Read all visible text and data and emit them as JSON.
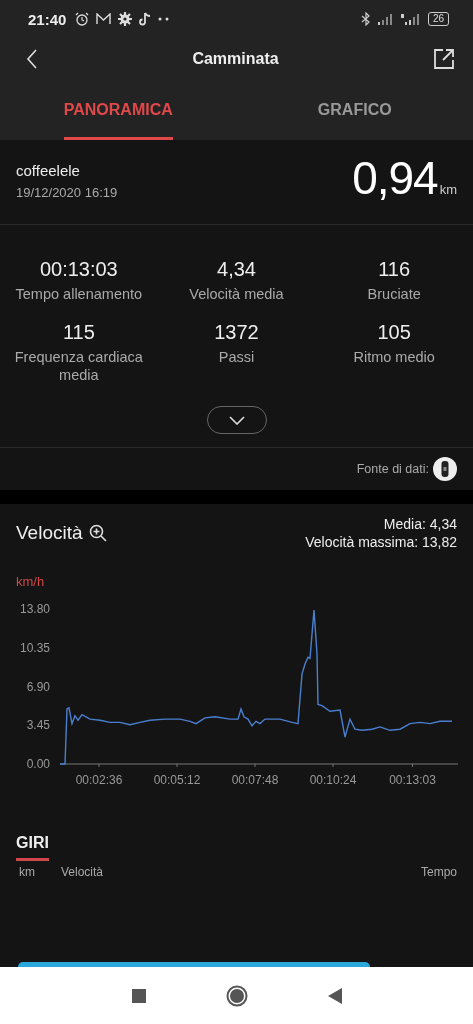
{
  "status_bar": {
    "time": "21:40",
    "battery": "26"
  },
  "header": {
    "title": "Camminata"
  },
  "tabs": [
    {
      "label": "PANORAMICA",
      "selected": true
    },
    {
      "label": "GRAFICO",
      "selected": false
    }
  ],
  "summary": {
    "user": "coffeelele",
    "datetime": "19/12/2020 16:19",
    "distance": "0,94",
    "unit": "km"
  },
  "stats": [
    {
      "value": "00:13:03",
      "label": "Tempo allenamento"
    },
    {
      "value": "4,34",
      "label": "Velocità media"
    },
    {
      "value": "116",
      "label": "Bruciate"
    },
    {
      "value": "115",
      "label": "Frequenza cardiaca media"
    },
    {
      "value": "1372",
      "label": "Passi"
    },
    {
      "value": "105",
      "label": "Ritmo medio"
    }
  ],
  "data_source": {
    "label": "Fonte di dati:"
  },
  "speed": {
    "title": "Velocità",
    "average": "Media: 4,34",
    "max": "Velocità massima: 13,82",
    "chart_data": {
      "type": "line",
      "ylabel": "km/h",
      "xlim": [
        78,
        872
      ],
      "ylim": [
        0,
        13.8
      ],
      "yticks": [
        {
          "value": 0,
          "label": "0.00"
        },
        {
          "value": 3.45,
          "label": "3.45"
        },
        {
          "value": 6.9,
          "label": "6.90"
        },
        {
          "value": 10.35,
          "label": "10.35"
        },
        {
          "value": 13.8,
          "label": "13.80"
        }
      ],
      "xticks": [
        {
          "value": 156,
          "label": "00:02:36"
        },
        {
          "value": 312,
          "label": "00:05:12"
        },
        {
          "value": 468,
          "label": "00:07:48"
        },
        {
          "value": 624,
          "label": "00:10:24"
        },
        {
          "value": 783,
          "label": "00:13:03"
        }
      ],
      "x": [
        78,
        88,
        92,
        96,
        102,
        108,
        114,
        122,
        138,
        158,
        178,
        198,
        218,
        238,
        258,
        288,
        318,
        338,
        350,
        368,
        388,
        418,
        434,
        440,
        446,
        454,
        462,
        470,
        478,
        488,
        518,
        542,
        554,
        562,
        568,
        574,
        578,
        586,
        592,
        594,
        602,
        618,
        638,
        648,
        658,
        668,
        682,
        702,
        718,
        738,
        758,
        778,
        798,
        818,
        838,
        862
      ],
      "series": [
        {
          "color": "#4a7fd0",
          "values": [
            0,
            0,
            4.9,
            5,
            3.6,
            4.3,
            3.9,
            4.4,
            4,
            3.9,
            3.7,
            3.7,
            3.5,
            3.7,
            3.9,
            4,
            4,
            3.8,
            3.6,
            4.1,
            4.2,
            4,
            4,
            4.9,
            4.2,
            4,
            3.4,
            3.8,
            3.6,
            4,
            4,
            3.7,
            3.6,
            8,
            8.9,
            9.5,
            9.4,
            13.7,
            9.8,
            5.3,
            5.2,
            4.7,
            4.8,
            2.4,
            4,
            3.1,
            3,
            3.1,
            3.3,
            3,
            3.1,
            3.6,
            3.7,
            3.6,
            3.8,
            3.8
          ]
        }
      ]
    }
  },
  "laps": {
    "title": "GIRI",
    "columns": [
      "km",
      "Velocità",
      "Tempo"
    ]
  }
}
